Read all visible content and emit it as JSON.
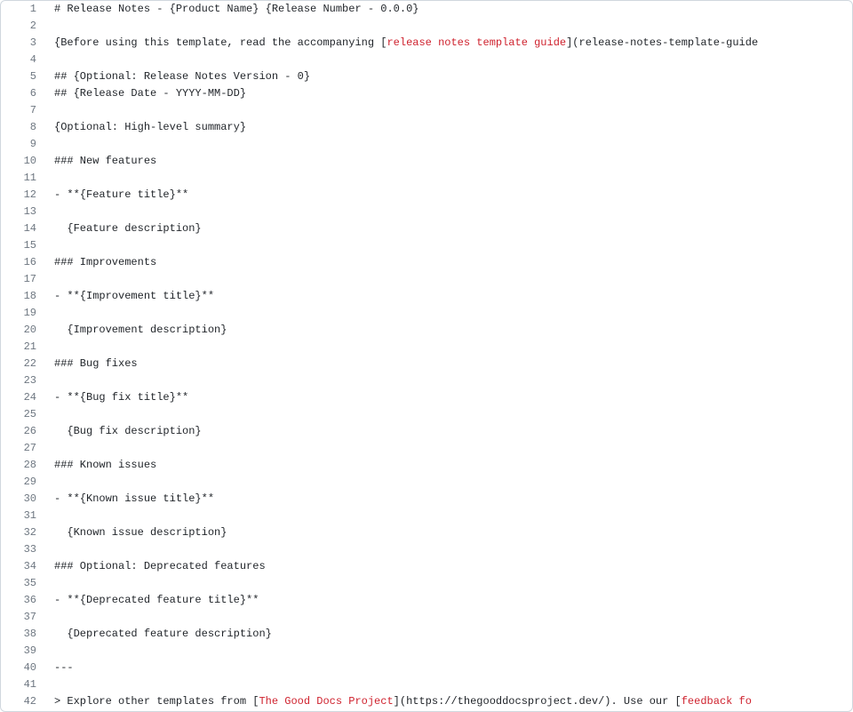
{
  "lines": [
    {
      "n": 1,
      "segments": [
        {
          "t": "# Release Notes - {Product Name} {Release Number - 0.0.0}",
          "c": "pl-text"
        }
      ]
    },
    {
      "n": 2,
      "segments": []
    },
    {
      "n": 3,
      "segments": [
        {
          "t": "{Before using this template, read the accompanying [",
          "c": "pl-text"
        },
        {
          "t": "release notes template guide",
          "c": "pl-link-text"
        },
        {
          "t": "](release-notes-template-guide",
          "c": "pl-text"
        }
      ]
    },
    {
      "n": 4,
      "segments": []
    },
    {
      "n": 5,
      "segments": [
        {
          "t": "## {Optional: Release Notes Version - 0}",
          "c": "pl-text"
        }
      ]
    },
    {
      "n": 6,
      "segments": [
        {
          "t": "## {Release Date - YYYY-MM-DD}",
          "c": "pl-text"
        }
      ]
    },
    {
      "n": 7,
      "segments": []
    },
    {
      "n": 8,
      "segments": [
        {
          "t": "{Optional: High-level summary}",
          "c": "pl-text"
        }
      ]
    },
    {
      "n": 9,
      "segments": []
    },
    {
      "n": 10,
      "segments": [
        {
          "t": "### New features",
          "c": "pl-text"
        }
      ]
    },
    {
      "n": 11,
      "segments": []
    },
    {
      "n": 12,
      "segments": [
        {
          "t": "- **{Feature title}**",
          "c": "pl-text"
        }
      ]
    },
    {
      "n": 13,
      "segments": []
    },
    {
      "n": 14,
      "segments": [
        {
          "t": "  {Feature description}",
          "c": "pl-text"
        }
      ]
    },
    {
      "n": 15,
      "segments": []
    },
    {
      "n": 16,
      "segments": [
        {
          "t": "### Improvements",
          "c": "pl-text"
        }
      ]
    },
    {
      "n": 17,
      "segments": []
    },
    {
      "n": 18,
      "segments": [
        {
          "t": "- **{Improvement title}**",
          "c": "pl-text"
        }
      ]
    },
    {
      "n": 19,
      "segments": []
    },
    {
      "n": 20,
      "segments": [
        {
          "t": "  {Improvement description}",
          "c": "pl-text"
        }
      ]
    },
    {
      "n": 21,
      "segments": []
    },
    {
      "n": 22,
      "segments": [
        {
          "t": "### Bug fixes",
          "c": "pl-text"
        }
      ]
    },
    {
      "n": 23,
      "segments": []
    },
    {
      "n": 24,
      "segments": [
        {
          "t": "- **{Bug fix title}**",
          "c": "pl-text"
        }
      ]
    },
    {
      "n": 25,
      "segments": []
    },
    {
      "n": 26,
      "segments": [
        {
          "t": "  {Bug fix description}",
          "c": "pl-text"
        }
      ]
    },
    {
      "n": 27,
      "segments": []
    },
    {
      "n": 28,
      "segments": [
        {
          "t": "### Known issues",
          "c": "pl-text"
        }
      ]
    },
    {
      "n": 29,
      "segments": []
    },
    {
      "n": 30,
      "segments": [
        {
          "t": "- **{Known issue title}**",
          "c": "pl-text"
        }
      ]
    },
    {
      "n": 31,
      "segments": []
    },
    {
      "n": 32,
      "segments": [
        {
          "t": "  {Known issue description}",
          "c": "pl-text"
        }
      ]
    },
    {
      "n": 33,
      "segments": []
    },
    {
      "n": 34,
      "segments": [
        {
          "t": "### Optional: Deprecated features",
          "c": "pl-text"
        }
      ]
    },
    {
      "n": 35,
      "segments": []
    },
    {
      "n": 36,
      "segments": [
        {
          "t": "- **{Deprecated feature title}**",
          "c": "pl-text"
        }
      ]
    },
    {
      "n": 37,
      "segments": []
    },
    {
      "n": 38,
      "segments": [
        {
          "t": "  {Deprecated feature description}",
          "c": "pl-text"
        }
      ]
    },
    {
      "n": 39,
      "segments": []
    },
    {
      "n": 40,
      "segments": [
        {
          "t": "---",
          "c": "pl-text"
        }
      ]
    },
    {
      "n": 41,
      "segments": []
    },
    {
      "n": 42,
      "segments": [
        {
          "t": "> Explore other templates from [",
          "c": "pl-text"
        },
        {
          "t": "The Good Docs Project",
          "c": "pl-link-text"
        },
        {
          "t": "](https://thegooddocsproject.dev/). Use our [",
          "c": "pl-text"
        },
        {
          "t": "feedback fo",
          "c": "pl-link-text"
        }
      ]
    }
  ]
}
